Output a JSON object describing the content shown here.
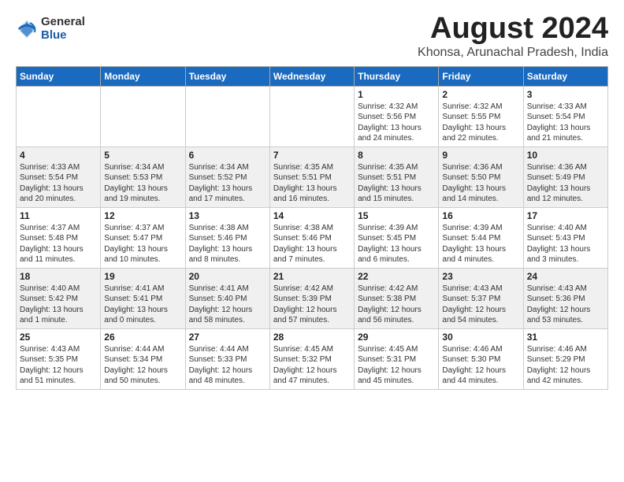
{
  "header": {
    "logo_general": "General",
    "logo_blue": "Blue",
    "month_title": "August 2024",
    "location": "Khonsa, Arunachal Pradesh, India"
  },
  "weekdays": [
    "Sunday",
    "Monday",
    "Tuesday",
    "Wednesday",
    "Thursday",
    "Friday",
    "Saturday"
  ],
  "weeks": [
    [
      {
        "day": "",
        "info": ""
      },
      {
        "day": "",
        "info": ""
      },
      {
        "day": "",
        "info": ""
      },
      {
        "day": "",
        "info": ""
      },
      {
        "day": "1",
        "info": "Sunrise: 4:32 AM\nSunset: 5:56 PM\nDaylight: 13 hours\nand 24 minutes."
      },
      {
        "day": "2",
        "info": "Sunrise: 4:32 AM\nSunset: 5:55 PM\nDaylight: 13 hours\nand 22 minutes."
      },
      {
        "day": "3",
        "info": "Sunrise: 4:33 AM\nSunset: 5:54 PM\nDaylight: 13 hours\nand 21 minutes."
      }
    ],
    [
      {
        "day": "4",
        "info": "Sunrise: 4:33 AM\nSunset: 5:54 PM\nDaylight: 13 hours\nand 20 minutes."
      },
      {
        "day": "5",
        "info": "Sunrise: 4:34 AM\nSunset: 5:53 PM\nDaylight: 13 hours\nand 19 minutes."
      },
      {
        "day": "6",
        "info": "Sunrise: 4:34 AM\nSunset: 5:52 PM\nDaylight: 13 hours\nand 17 minutes."
      },
      {
        "day": "7",
        "info": "Sunrise: 4:35 AM\nSunset: 5:51 PM\nDaylight: 13 hours\nand 16 minutes."
      },
      {
        "day": "8",
        "info": "Sunrise: 4:35 AM\nSunset: 5:51 PM\nDaylight: 13 hours\nand 15 minutes."
      },
      {
        "day": "9",
        "info": "Sunrise: 4:36 AM\nSunset: 5:50 PM\nDaylight: 13 hours\nand 14 minutes."
      },
      {
        "day": "10",
        "info": "Sunrise: 4:36 AM\nSunset: 5:49 PM\nDaylight: 13 hours\nand 12 minutes."
      }
    ],
    [
      {
        "day": "11",
        "info": "Sunrise: 4:37 AM\nSunset: 5:48 PM\nDaylight: 13 hours\nand 11 minutes."
      },
      {
        "day": "12",
        "info": "Sunrise: 4:37 AM\nSunset: 5:47 PM\nDaylight: 13 hours\nand 10 minutes."
      },
      {
        "day": "13",
        "info": "Sunrise: 4:38 AM\nSunset: 5:46 PM\nDaylight: 13 hours\nand 8 minutes."
      },
      {
        "day": "14",
        "info": "Sunrise: 4:38 AM\nSunset: 5:46 PM\nDaylight: 13 hours\nand 7 minutes."
      },
      {
        "day": "15",
        "info": "Sunrise: 4:39 AM\nSunset: 5:45 PM\nDaylight: 13 hours\nand 6 minutes."
      },
      {
        "day": "16",
        "info": "Sunrise: 4:39 AM\nSunset: 5:44 PM\nDaylight: 13 hours\nand 4 minutes."
      },
      {
        "day": "17",
        "info": "Sunrise: 4:40 AM\nSunset: 5:43 PM\nDaylight: 13 hours\nand 3 minutes."
      }
    ],
    [
      {
        "day": "18",
        "info": "Sunrise: 4:40 AM\nSunset: 5:42 PM\nDaylight: 13 hours\nand 1 minute."
      },
      {
        "day": "19",
        "info": "Sunrise: 4:41 AM\nSunset: 5:41 PM\nDaylight: 13 hours\nand 0 minutes."
      },
      {
        "day": "20",
        "info": "Sunrise: 4:41 AM\nSunset: 5:40 PM\nDaylight: 12 hours\nand 58 minutes."
      },
      {
        "day": "21",
        "info": "Sunrise: 4:42 AM\nSunset: 5:39 PM\nDaylight: 12 hours\nand 57 minutes."
      },
      {
        "day": "22",
        "info": "Sunrise: 4:42 AM\nSunset: 5:38 PM\nDaylight: 12 hours\nand 56 minutes."
      },
      {
        "day": "23",
        "info": "Sunrise: 4:43 AM\nSunset: 5:37 PM\nDaylight: 12 hours\nand 54 minutes."
      },
      {
        "day": "24",
        "info": "Sunrise: 4:43 AM\nSunset: 5:36 PM\nDaylight: 12 hours\nand 53 minutes."
      }
    ],
    [
      {
        "day": "25",
        "info": "Sunrise: 4:43 AM\nSunset: 5:35 PM\nDaylight: 12 hours\nand 51 minutes."
      },
      {
        "day": "26",
        "info": "Sunrise: 4:44 AM\nSunset: 5:34 PM\nDaylight: 12 hours\nand 50 minutes."
      },
      {
        "day": "27",
        "info": "Sunrise: 4:44 AM\nSunset: 5:33 PM\nDaylight: 12 hours\nand 48 minutes."
      },
      {
        "day": "28",
        "info": "Sunrise: 4:45 AM\nSunset: 5:32 PM\nDaylight: 12 hours\nand 47 minutes."
      },
      {
        "day": "29",
        "info": "Sunrise: 4:45 AM\nSunset: 5:31 PM\nDaylight: 12 hours\nand 45 minutes."
      },
      {
        "day": "30",
        "info": "Sunrise: 4:46 AM\nSunset: 5:30 PM\nDaylight: 12 hours\nand 44 minutes."
      },
      {
        "day": "31",
        "info": "Sunrise: 4:46 AM\nSunset: 5:29 PM\nDaylight: 12 hours\nand 42 minutes."
      }
    ]
  ]
}
